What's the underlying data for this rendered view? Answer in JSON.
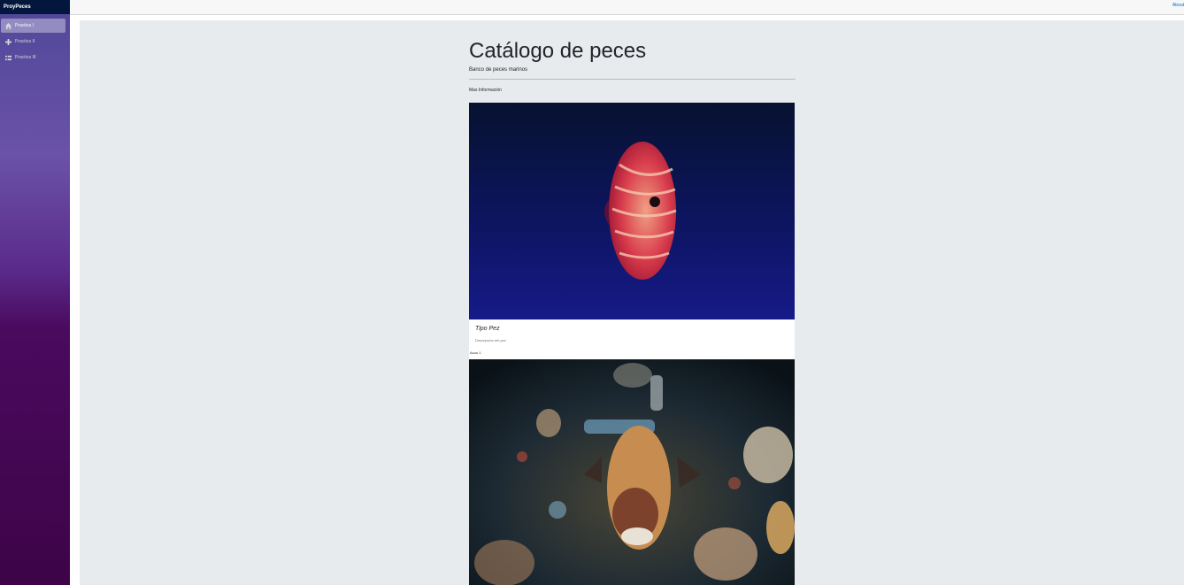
{
  "sidebar": {
    "brand": "ProyPeces",
    "items": [
      {
        "label": "Practica I",
        "icon": "home-icon",
        "active": true
      },
      {
        "label": "Practica II",
        "icon": "plus-icon",
        "active": false
      },
      {
        "label": "Practica III",
        "icon": "list-icon",
        "active": false
      }
    ]
  },
  "topbar": {
    "about": "About"
  },
  "main": {
    "title": "Catálogo de peces",
    "lead": "Banco de peces marinos",
    "more": "Mas Información",
    "cards": [
      {
        "title": "Tipo Pez",
        "text": "Descripción del pez",
        "link": "Acuo 1"
      }
    ]
  }
}
